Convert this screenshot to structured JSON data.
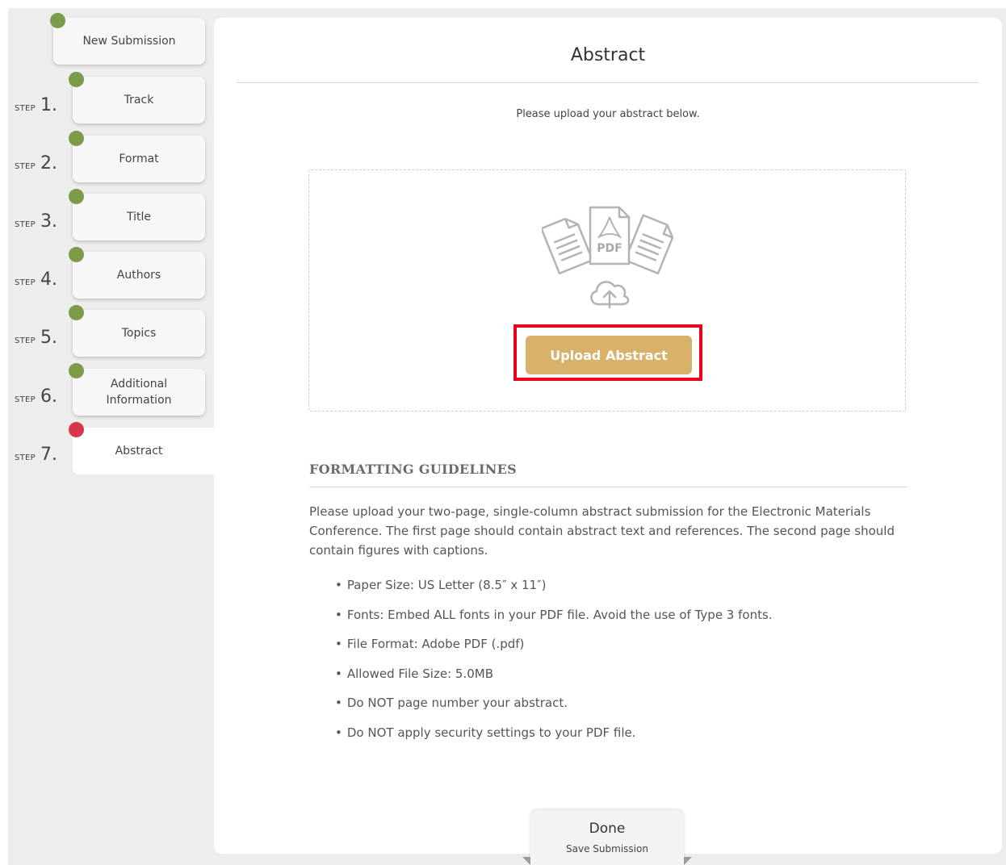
{
  "sidebar": {
    "new_submission": "New Submission",
    "step_word": "STEP",
    "steps": [
      {
        "num": "1.",
        "label": "Track",
        "status": "complete"
      },
      {
        "num": "2.",
        "label": "Format",
        "status": "complete"
      },
      {
        "num": "3.",
        "label": "Title",
        "status": "complete"
      },
      {
        "num": "4.",
        "label": "Authors",
        "status": "complete"
      },
      {
        "num": "5.",
        "label": "Topics",
        "status": "complete"
      },
      {
        "num": "6.",
        "label": "Additional Information",
        "status": "complete"
      },
      {
        "num": "7.",
        "label": "Abstract",
        "status": "current"
      }
    ],
    "colors": {
      "complete": "#7b9a4a",
      "current": "#d7364a"
    }
  },
  "main": {
    "title": "Abstract",
    "intro": "Please upload your abstract below.",
    "upload": {
      "graphic_text": "PDF",
      "button_label": "Upload Abstract",
      "button_color": "#d8b26a",
      "highlight_color": "#e8001c"
    },
    "guidelines": {
      "heading": "FORMATTING GUIDELINES",
      "paragraph": "Please upload your two-page, single-column abstract submission for the Electronic Materials Conference. The first page should contain abstract text and references. The second page should contain figures with captions.",
      "items": [
        "Paper Size: US Letter (8.5″ x 11″)",
        "Fonts: Embed ALL fonts in your PDF file. Avoid the use of Type 3 fonts.",
        "File Format: Adobe PDF (.pdf)",
        "Allowed File Size: 5.0MB",
        "Do NOT page number your abstract.",
        "Do NOT apply security settings to your PDF file."
      ]
    }
  },
  "footer": {
    "done_label": "Done",
    "done_sub": "Save Submission"
  },
  "icons": {
    "step_dot": "status-dot-icon",
    "upload_graphic": "pdf-upload-icon",
    "cloud": "cloud-upload-icon"
  }
}
